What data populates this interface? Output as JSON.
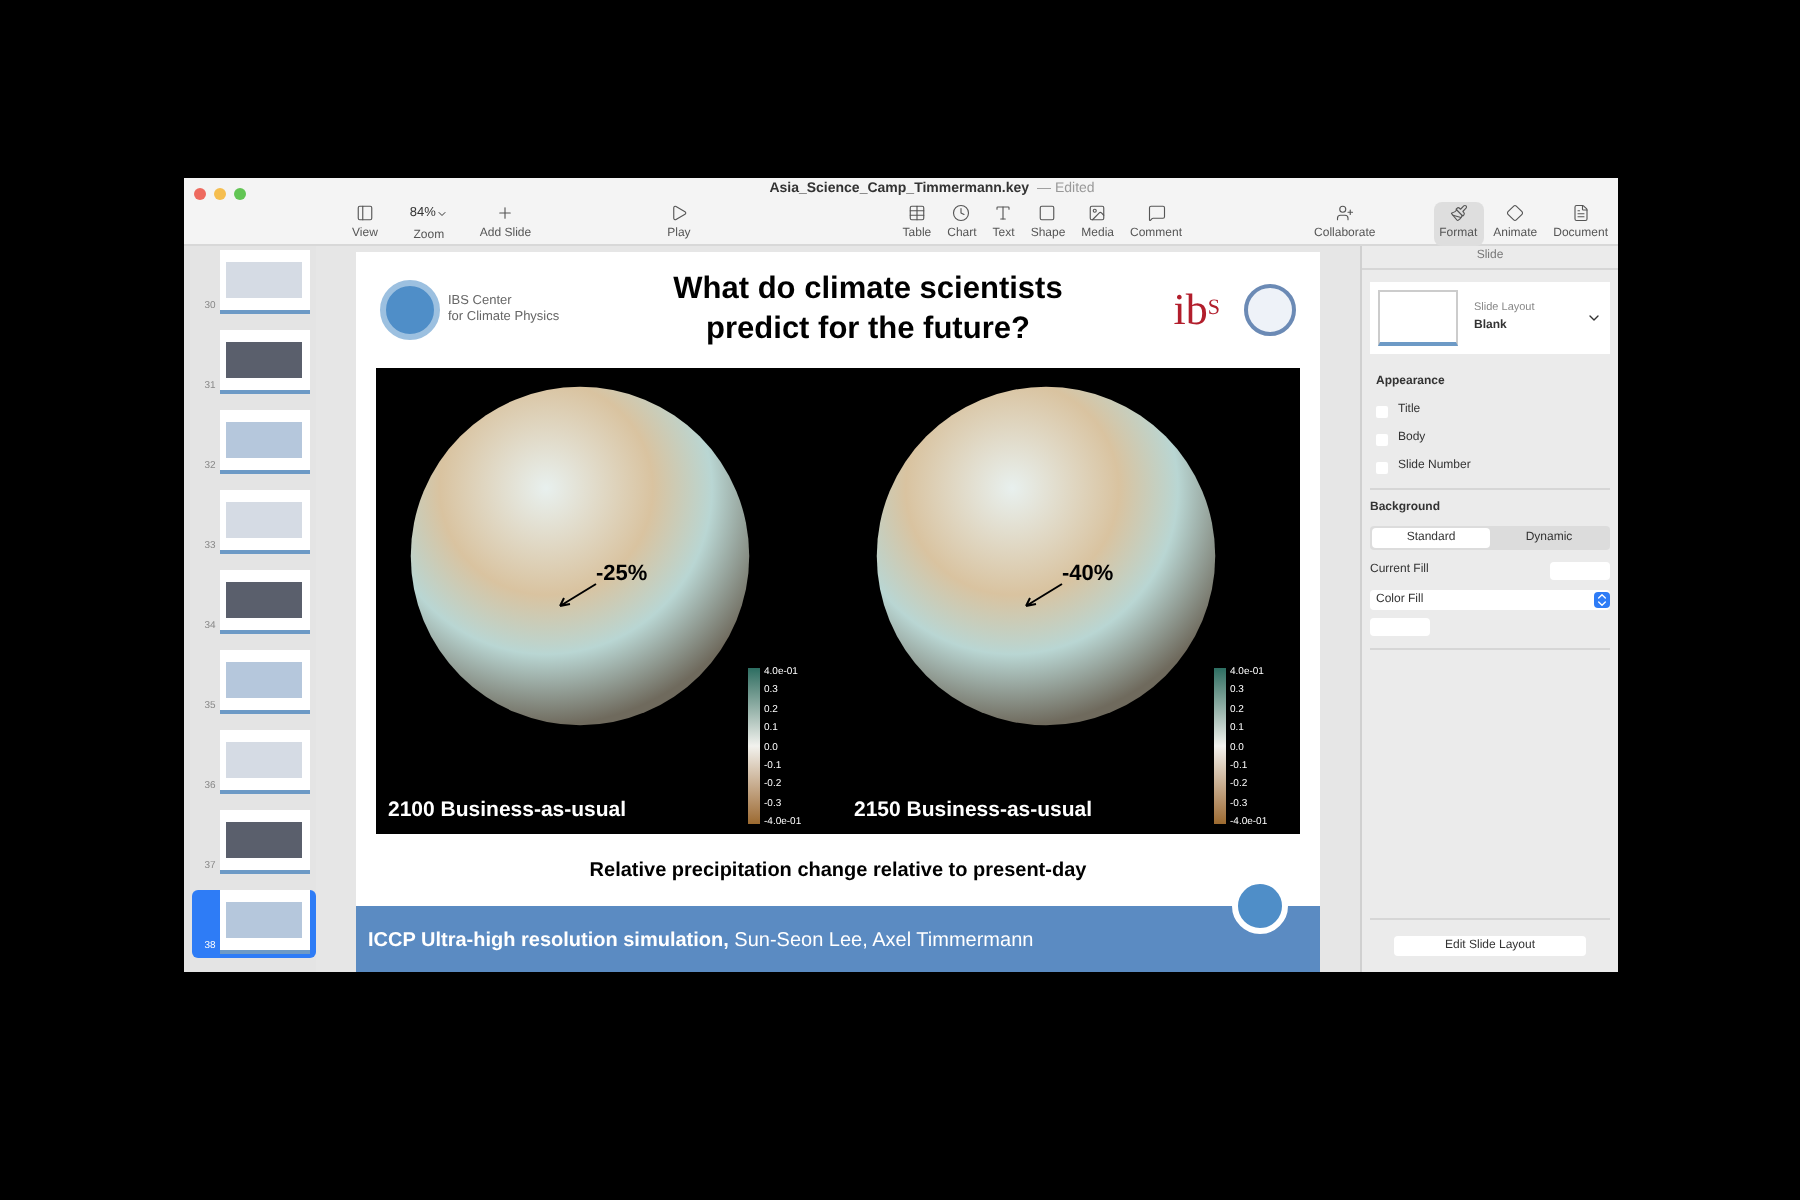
{
  "window": {
    "title": "Asia_Science_Camp_Timmermann.key",
    "status": "— Edited"
  },
  "toolbar": {
    "left": [
      {
        "label": "View"
      },
      {
        "label": "Zoom",
        "value": "84%"
      },
      {
        "label": "Add Slide"
      }
    ],
    "middle": [
      {
        "label": "Play"
      }
    ],
    "insert": [
      {
        "label": "Table"
      },
      {
        "label": "Chart"
      },
      {
        "label": "Text"
      },
      {
        "label": "Shape"
      },
      {
        "label": "Media"
      },
      {
        "label": "Comment"
      }
    ],
    "collab": [
      {
        "label": "Collaborate"
      }
    ],
    "right": [
      {
        "label": "Format",
        "selected": true
      },
      {
        "label": "Animate",
        "selected": false
      },
      {
        "label": "Document",
        "selected": false
      }
    ]
  },
  "navigator": {
    "slides": [
      {
        "number": "30",
        "selected": false
      },
      {
        "number": "31",
        "selected": false
      },
      {
        "number": "32",
        "selected": false
      },
      {
        "number": "33",
        "selected": false
      },
      {
        "number": "34",
        "selected": false
      },
      {
        "number": "35",
        "selected": false
      },
      {
        "number": "36",
        "selected": false
      },
      {
        "number": "37",
        "selected": false
      },
      {
        "number": "38",
        "selected": true
      }
    ]
  },
  "slide": {
    "logo_text": [
      "IBS Center",
      "for Climate Physics"
    ],
    "title": [
      "What do climate scientists",
      "predict for the future?"
    ],
    "ibs_logo": "ib",
    "ibs_logo_sup": "S",
    "panels": [
      {
        "label": "2100 Business-as-usual",
        "change": "-25%",
        "colorbar_ticks": [
          "4.0e-01",
          "0.3",
          "0.2",
          "0.1",
          "0.0",
          "-0.1",
          "-0.2",
          "-0.3",
          "-4.0e-01"
        ]
      },
      {
        "label": "2150 Business-as-usual",
        "change": "-40%",
        "colorbar_ticks": [
          "4.0e-01",
          "0.3",
          "0.2",
          "0.1",
          "0.0",
          "-0.1",
          "-0.2",
          "-0.3",
          "-4.0e-01"
        ]
      }
    ],
    "caption": "Relative precipitation change relative to present-day",
    "footer": "**ICCP Ultra-high resolution simulation,** Sun-Seon Lee, Axel Timmermann"
  },
  "inspector": {
    "header": "Slide",
    "layout_label": "Slide Layout",
    "layout_value": "Blank",
    "appearance_title": "Appearance",
    "appearance": [
      {
        "label": "Title",
        "checked": false
      },
      {
        "label": "Body",
        "checked": false
      },
      {
        "label": "Slide Number",
        "checked": false
      }
    ],
    "background_title": "Background",
    "background_tabs": [
      {
        "label": "Standard",
        "selected": true
      },
      {
        "label": "Dynamic",
        "selected": false
      }
    ],
    "current_fill": "Current Fill",
    "fill_type": "Color Fill",
    "edit_button": "Edit Slide Layout"
  }
}
